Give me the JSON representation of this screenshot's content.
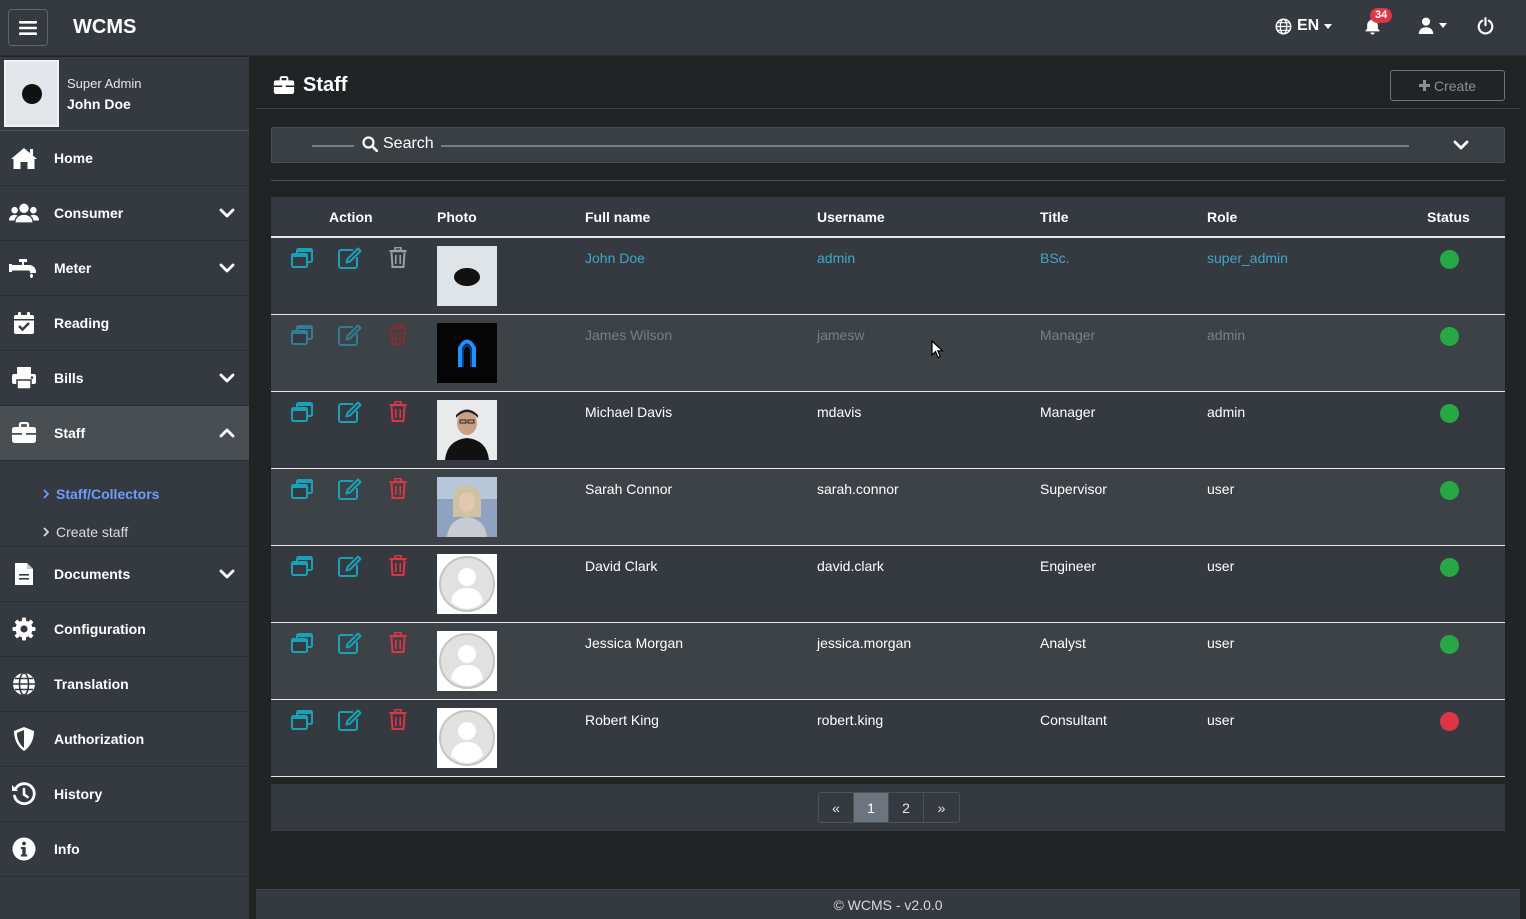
{
  "app": {
    "brand": "WCMS"
  },
  "topbar": {
    "language": "EN",
    "notification_count": "34",
    "icons": [
      "hamburger-icon",
      "globe-icon",
      "bell-icon",
      "user-icon",
      "power-icon"
    ]
  },
  "user": {
    "role": "Super Admin",
    "name": "John Doe"
  },
  "sidebar": {
    "items": [
      {
        "label": "Home",
        "icon": "home-icon"
      },
      {
        "label": "Consumer",
        "icon": "users-icon"
      },
      {
        "label": "Meter",
        "icon": "faucet-icon"
      },
      {
        "label": "Reading",
        "icon": "calendar-check-icon"
      },
      {
        "label": "Bills",
        "icon": "printer-icon"
      },
      {
        "label": "Staff",
        "icon": "briefcase-icon"
      },
      {
        "label": "Documents",
        "icon": "file-icon"
      },
      {
        "label": "Configuration",
        "icon": "gear-icon"
      },
      {
        "label": "Translation",
        "icon": "globe-icon"
      },
      {
        "label": "Authorization",
        "icon": "shield-icon"
      },
      {
        "label": "History",
        "icon": "history-icon"
      },
      {
        "label": "Info",
        "icon": "info-icon"
      }
    ],
    "staff_submenu": [
      {
        "label": "Staff/Collectors"
      },
      {
        "label": "Create staff"
      }
    ]
  },
  "page": {
    "title": "Staff",
    "create_label": "Create"
  },
  "search": {
    "label": "Search"
  },
  "table": {
    "headers": {
      "action": "Action",
      "photo": "Photo",
      "full_name": "Full name",
      "username": "Username",
      "title": "Title",
      "role": "Role",
      "status": "Status"
    },
    "rows": [
      {
        "full_name": "John Doe",
        "username": "admin",
        "title": "BSc.",
        "role": "super_admin",
        "status": "active",
        "photo": "dark-oval-avatar"
      },
      {
        "full_name": "James Wilson",
        "username": "jamesw",
        "title": "Manager",
        "role": "admin",
        "status": "active",
        "photo": "blue-horseshoe-avatar"
      },
      {
        "full_name": "Michael Davis",
        "username": "mdavis",
        "title": "Manager",
        "role": "admin",
        "status": "active",
        "photo": "man-portrait-photo"
      },
      {
        "full_name": "Sarah Connor",
        "username": "sarah.connor",
        "title": "Supervisor",
        "role": "user",
        "status": "active",
        "photo": "woman-portrait-photo"
      },
      {
        "full_name": "David Clark",
        "username": "david.clark",
        "title": "Engineer",
        "role": "user",
        "status": "active",
        "photo": "default-avatar"
      },
      {
        "full_name": "Jessica Morgan",
        "username": "jessica.morgan",
        "title": "Analyst",
        "role": "user",
        "status": "active",
        "photo": "default-avatar"
      },
      {
        "full_name": "Robert King",
        "username": "robert.king",
        "title": "Consultant",
        "role": "user",
        "status": "inactive",
        "photo": "default-avatar"
      }
    ]
  },
  "pagination": {
    "prev": "«",
    "pages": [
      "1",
      "2"
    ],
    "current": "1",
    "next": "»"
  },
  "footer": {
    "text": "© WCMS - v2.0.0"
  },
  "colors": {
    "link": "#3fa7c9",
    "active_status": "#28a745",
    "inactive_status": "#dc3545",
    "delete": "#dc3545",
    "edit": "#17a2b8"
  }
}
